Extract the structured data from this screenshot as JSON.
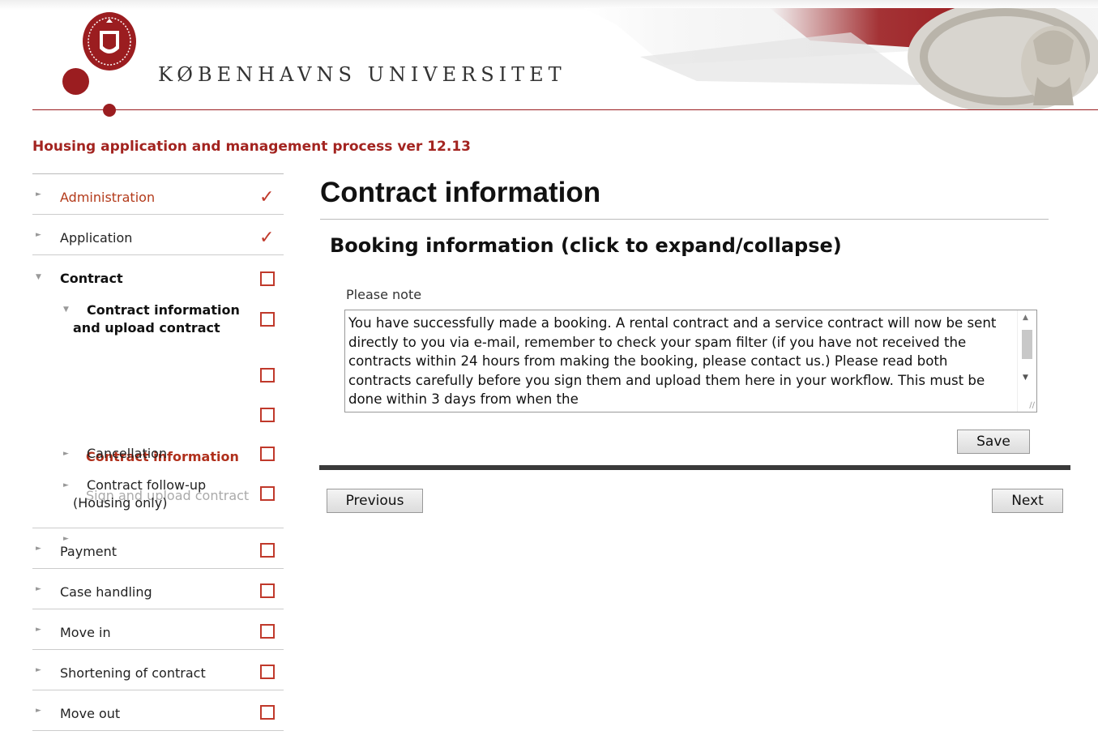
{
  "header": {
    "university_name": "KØBENHAVNS UNIVERSITET",
    "logo_icon": "university-seal-icon",
    "brand_color": "#9b1d20"
  },
  "process_title": "Housing application and management process ver 12.13",
  "sidebar": {
    "items": [
      {
        "label": "Administration",
        "status": "done"
      },
      {
        "label": "Application",
        "status": "done"
      },
      {
        "label": "Contract",
        "status": "open",
        "expanded": true,
        "children": [
          {
            "label_line1": "Contract information",
            "label_line2": "and upload contract",
            "status": "open",
            "expanded": true,
            "children": [
              {
                "label": "Contract information",
                "status": "active"
              },
              {
                "label": "Sign and upload contract",
                "status": "disabled"
              }
            ]
          },
          {
            "label": "Cancellation",
            "status": "open"
          },
          {
            "label_line1": "Contract follow-up",
            "label_line2": "(Housing only)",
            "status": "open"
          }
        ]
      },
      {
        "label": "Payment",
        "status": "open"
      },
      {
        "label": "Case handling",
        "status": "open"
      },
      {
        "label": "Move in",
        "status": "open"
      },
      {
        "label": "Shortening of contract",
        "status": "open"
      },
      {
        "label": "Move out",
        "status": "open"
      }
    ]
  },
  "main": {
    "title": "Contract information",
    "section_title": "Booking information (click to expand/collapse)",
    "note_label": "Please note",
    "note_text": "You have successfully made a booking. A rental contract and a service contract will now be sent directly to you via e-mail, remember to check your spam filter (if you have not received the contracts within 24 hours from making the booking, please contact us.) Please read both contracts carefully before you sign them and upload them here in your workflow. This must be done within 3 days from when the",
    "save_label": "Save",
    "previous_label": "Previous",
    "next_label": "Next"
  },
  "colors": {
    "accent": "#a32420",
    "checkbox": "#c0392b",
    "divider": "#3a3a3a"
  }
}
